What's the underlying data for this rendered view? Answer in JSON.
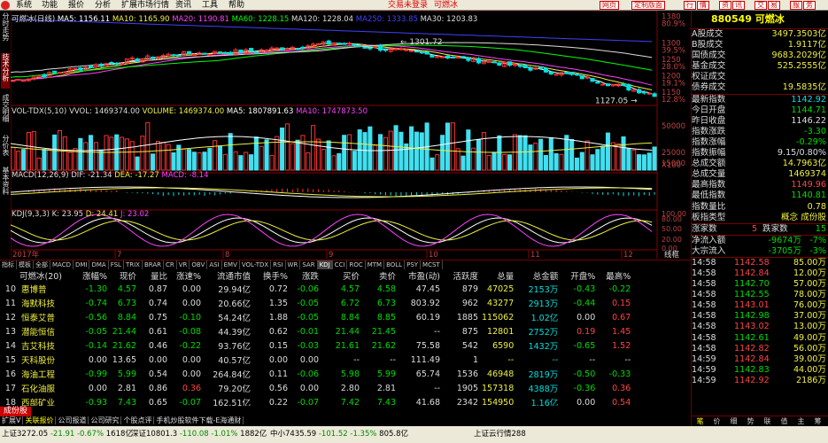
{
  "menu": {
    "items": [
      "系统",
      "功能",
      "报价",
      "分析",
      "扩展市场行情",
      "资讯",
      "工具",
      "帮助"
    ],
    "status1": "交易未登录",
    "status2": "可燃冰",
    "right_buttons": [
      "网页",
      "定制版面",
      "行",
      "情",
      "资",
      "讯",
      "交",
      "易",
      "服",
      "务"
    ]
  },
  "vertical_tabs": [
    "分时走势",
    "技术分析",
    "成交明细",
    "分价表",
    "基本资料"
  ],
  "kline": {
    "title": "可燃冰(日线)",
    "ma": [
      {
        "label": "MA5: 1156.11",
        "color": "#ffffff"
      },
      {
        "label": "MA10: 1165.90",
        "color": "#f0f040"
      },
      {
        "label": "MA20: 1190.81",
        "color": "#ff40ff"
      },
      {
        "label": "MA60: 1228.15",
        "color": "#00ff00"
      },
      {
        "label": "MA120: 1228.04",
        "color": "#dddddd"
      },
      {
        "label": "MA250: 1333.85",
        "color": "#4040ff"
      },
      {
        "label": "MA30: 1203.83",
        "color": "#dddddd"
      }
    ],
    "high_label": "1301.72",
    "low_label": "1127.05",
    "axis": [
      "1380",
      "1300",
      "1250",
      "1200",
      "1150"
    ],
    "pct": [
      "80.9%",
      "39.5%",
      "28.0%",
      "19.1%",
      "12.8%"
    ]
  },
  "vol": {
    "title": "VOL-TDX(5,10)",
    "vals": [
      "VVOL: 1469374.00",
      "VOLUME: 1469374.00",
      "MA5: 1807891.63",
      "MA10: 1747873.50"
    ],
    "axis": [
      "50000",
      "25000",
      "15000"
    ],
    "mult": "X100"
  },
  "macd": {
    "title": "MACD(12,26,9)",
    "vals": [
      "DIF: -21.34",
      "DEA: -17.27",
      "MACD: -8.14"
    ]
  },
  "kdj": {
    "title": "KDJ(9,3,3)",
    "vals": [
      "K: 23.95",
      "D: 24.41",
      "J: 23.02"
    ],
    "axis": [
      "100.00",
      "80.00",
      "50.00",
      "20.00",
      "0.00"
    ]
  },
  "dates": {
    "labels": [
      "2017年",
      "7",
      "8",
      "9",
      "10",
      "11",
      "12"
    ]
  },
  "indicator_bar": [
    "指标",
    "模板",
    "全部",
    "MACD",
    "DMI",
    "DMA",
    "FSL",
    "TRIX",
    "BRAR",
    "CR",
    "VR",
    "OBV",
    "ASI",
    "EMV",
    "VOL-TDX",
    "RSI",
    "WR",
    "SAR",
    "KDJ",
    "CCI",
    "ROC",
    "MTM",
    "BOLL",
    "PSY",
    "MCST"
  ],
  "indicator_selected": "KDJ",
  "chart_scroll": [
    "线框",
    "+",
    "−",
    "×"
  ],
  "table": {
    "headers": [
      "可燃冰(20)",
      "涨幅%",
      "现价",
      "量比",
      "涨速%",
      "流通市值",
      "换手%",
      "涨跌",
      "买价",
      "卖价",
      "市盈(动)",
      "活跃度",
      "总量",
      "总金额",
      "开盘%",
      "最高%"
    ],
    "rows": [
      [
        "10",
        "惠博普",
        "-1.30",
        "4.57",
        "0.87",
        "0.00",
        "29.94亿",
        "0.72",
        "-0.06",
        "4.57",
        "4.58",
        "47.45",
        "879",
        "47025",
        "2153万",
        "-0.43",
        "-0.22"
      ],
      [
        "11",
        "海默科技",
        "-0.74",
        "6.73",
        "0.74",
        "0.00",
        "20.66亿",
        "1.35",
        "-0.05",
        "6.72",
        "6.73",
        "803.92",
        "962",
        "43277",
        "2913万",
        "-0.44",
        "0.15"
      ],
      [
        "12",
        "恒泰艾普",
        "-0.56",
        "8.84",
        "0.75",
        "-0.10",
        "54.24亿",
        "1.88",
        "-0.05",
        "8.84",
        "8.85",
        "60.19",
        "1885",
        "115062",
        "1.02亿",
        "0.00",
        "0.67"
      ],
      [
        "13",
        "潜能恒信",
        "-0.05",
        "21.44",
        "0.61",
        "-0.08",
        "44.39亿",
        "0.62",
        "-0.01",
        "21.44",
        "21.45",
        "--",
        "875",
        "12801",
        "2752万",
        "0.19",
        "1.45"
      ],
      [
        "14",
        "吉艾科技",
        "-0.14",
        "21.62",
        "0.46",
        "-0.22",
        "93.76亿",
        "0.15",
        "-0.03",
        "21.61",
        "21.62",
        "75.58",
        "542",
        "6590",
        "1432万",
        "-0.65",
        "1.52"
      ],
      [
        "15",
        "天科股份",
        "0.00",
        "13.65",
        "0.00",
        "0.00",
        "40.57亿",
        "0.00",
        "0.00",
        "--",
        "--",
        "111.49",
        "1",
        "--",
        "--",
        "--",
        "--"
      ],
      [
        "16",
        "海油工程",
        "-0.99",
        "5.99",
        "0.54",
        "0.00",
        "264.84亿",
        "0.11",
        "-0.06",
        "5.98",
        "5.99",
        "65.74",
        "1536",
        "46948",
        "2819万",
        "-0.50",
        "-0.33"
      ],
      [
        "17",
        "石化油服",
        "0.00",
        "2.81",
        "0.86",
        "0.36",
        "79.20亿",
        "0.56",
        "0.00",
        "2.80",
        "2.81",
        "--",
        "1905",
        "157318",
        "4388万",
        "-0.36",
        "0.36"
      ],
      [
        "18",
        "西部矿业",
        "-0.93",
        "7.43",
        "0.65",
        "-0.07",
        "162.51亿",
        "0.22",
        "-0.07",
        "7.42",
        "7.43",
        "41.68",
        "2342",
        "154950",
        "1.16亿",
        "0.00",
        "0.54"
      ]
    ]
  },
  "bottom": {
    "config": "成份股",
    "tabs": [
      "扩展V",
      "关联报价",
      "公司报道",
      "公司研究",
      "个股点评",
      "手机炒股软件下载-E海通财"
    ],
    "selected": "关联报价"
  },
  "statusbar": {
    "sh": "上证3272.05",
    "sh_chg": "-21.91",
    "sh_pct": "-0.67%",
    "sh_amt": "1618亿",
    "sz": "深证10801.3",
    "sz_chg": "-110.08",
    "sz_pct": "-1.01%",
    "sz_amt": "1882亿",
    "zx": "中小7435.59",
    "zx_chg": "-101.52",
    "zx_pct": "-1.35%",
    "zx_amt": "805.8亿",
    "info": "上证云行情288"
  },
  "right": {
    "code_name": "880549 可燃冰",
    "trade": [
      [
        "A股成交",
        "3497.3503亿",
        "ye"
      ],
      [
        "B股成交",
        "1.9117亿",
        "ye"
      ],
      [
        "国债成交",
        "9683.2029亿",
        "ye"
      ],
      [
        "基金成交",
        "525.2555亿",
        "ye"
      ],
      [
        "权证成交",
        "",
        ""
      ],
      [
        "债券成交",
        "19.5835亿",
        "ye"
      ]
    ],
    "stats": [
      [
        "最新指数",
        "1142.92",
        "cy"
      ],
      [
        "今日开盘",
        "1144.71",
        "dn"
      ],
      [
        "昨日收盘",
        "1146.22",
        "wh"
      ],
      [
        "指数涨跌",
        "-3.30",
        "dn"
      ],
      [
        "指数涨幅",
        "-0.29%",
        "dn"
      ],
      [
        "指数振幅",
        "9.15/0.80%",
        "wh"
      ],
      [
        "总成交额",
        "14.7963亿",
        "ye"
      ],
      [
        "总成交量",
        "1469374",
        "ye"
      ],
      [
        "最高指数",
        "1149.96",
        "up"
      ],
      [
        "最低指数",
        "1140.81",
        "dn"
      ],
      [
        "指数量比",
        "0.78",
        "ye"
      ],
      [
        "板指类型",
        "概念 成份股",
        "ye"
      ]
    ],
    "rise_label": "涨家数",
    "rise": "5",
    "fall_label": "跌家数",
    "fall": "15",
    "flows": [
      [
        "净流入额",
        "-9674万",
        "-7%"
      ],
      [
        "大宗流入",
        "-3705万",
        "-3%"
      ]
    ],
    "ticks": [
      [
        "14:58",
        "1142.58",
        "85.00万"
      ],
      [
        "14:58",
        "1142.84",
        "12.00万"
      ],
      [
        "14:58",
        "1142.70",
        "57.00万"
      ],
      [
        "14:58",
        "1142.55",
        "78.00万"
      ],
      [
        "14:58",
        "1143.01",
        "76.00万"
      ],
      [
        "14:58",
        "1142.98",
        "37.00万"
      ],
      [
        "14:58",
        "1143.02",
        "13.00万"
      ],
      [
        "14:58",
        "1142.61",
        "49.00万"
      ],
      [
        "14:58",
        "1142.82",
        "56.00万"
      ],
      [
        "14:59",
        "1142.84",
        "39.00万"
      ],
      [
        "14:59",
        "1142.83",
        "44.00万"
      ],
      [
        "14:59",
        "1142.92",
        "2186万"
      ]
    ],
    "ticks_up": [
      true,
      true,
      false,
      false,
      true,
      false,
      true,
      false,
      true,
      true,
      false,
      true
    ],
    "bottom_tabs": [
      "笔",
      "价",
      "细",
      "势",
      "联",
      "值",
      "主",
      "筹"
    ]
  },
  "chart_data": {
    "type": "candlestick",
    "title": "可燃冰(日线)",
    "x": [
      "2017-06",
      "2017-07",
      "2017-08",
      "2017-09",
      "2017-10",
      "2017-11",
      "2017-12"
    ],
    "ylim": [
      1120,
      1390
    ],
    "series": [
      {
        "name": "可燃冰",
        "approx_close_path": [
          1185,
          1230,
          1265,
          1275,
          1300,
          1270,
          1240,
          1200,
          1142.92
        ]
      }
    ]
  }
}
